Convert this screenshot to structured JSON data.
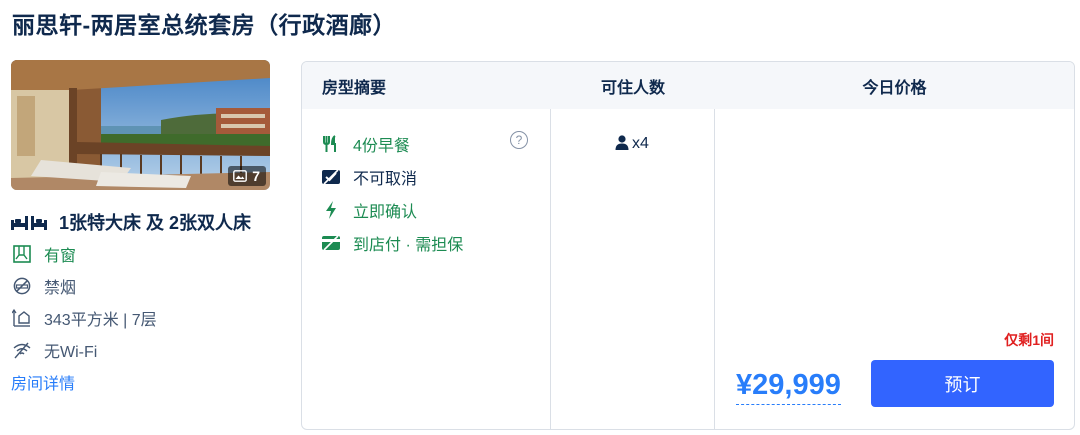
{
  "room": {
    "title": "丽思轩-两居室总统套房（行政酒廊）",
    "photo_count": "7",
    "bed": "1张特大床 及 2张双人床",
    "features": [
      {
        "icon": "window-icon",
        "text": "有窗"
      },
      {
        "icon": "no-smoking-icon",
        "text": "禁烟"
      },
      {
        "icon": "room-size-icon",
        "text": "343平方米 | 7层"
      },
      {
        "icon": "no-wifi-icon",
        "text": "无Wi-Fi"
      }
    ],
    "details_link": "房间详情"
  },
  "table": {
    "headers": {
      "summary": "房型摘要",
      "occupancy": "可住人数",
      "price": "今日价格"
    },
    "policies": [
      {
        "icon": "breakfast-icon",
        "text": "4份早餐",
        "color": "#1c8b52"
      },
      {
        "icon": "no-cancel-icon",
        "text": "不可取消",
        "color": "#0f294d"
      },
      {
        "icon": "instant-confirm-icon",
        "text": "立即确认",
        "color": "#1c8b52"
      },
      {
        "icon": "pay-at-hotel-icon",
        "text": "到店付 · 需担保",
        "color": "#1c8b52"
      }
    ],
    "occupancy": "x4",
    "only_left": "仅剩1间",
    "price": "¥29,999",
    "book_label": "预订"
  },
  "colors": {
    "accent": "#287dfa",
    "button": "#3264ff",
    "green": "#1c8b52",
    "alert": "#e02020"
  }
}
